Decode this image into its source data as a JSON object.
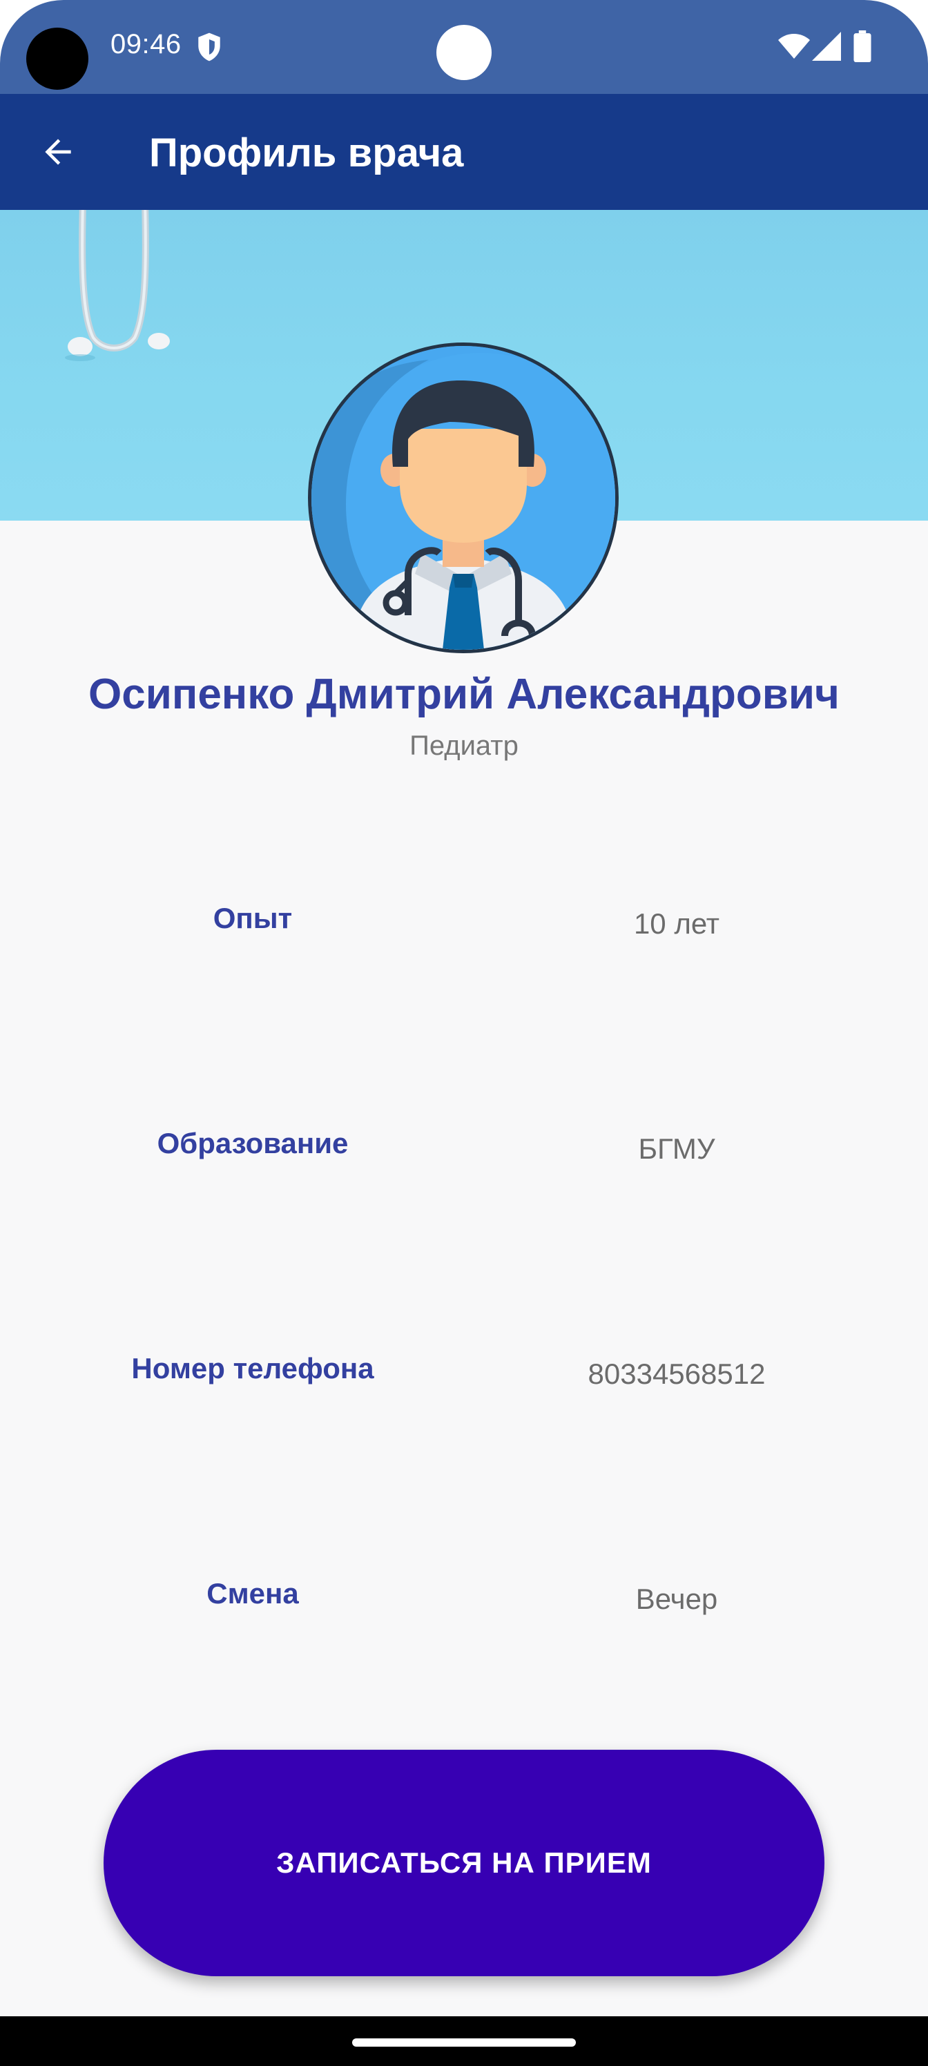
{
  "status_bar": {
    "time": "09:46",
    "icons": [
      "shield-icon",
      "wifi-icon",
      "signal-icon",
      "battery-icon"
    ]
  },
  "app_bar": {
    "title": "Профиль врача",
    "back_icon": "arrow-left-icon"
  },
  "doctor": {
    "name": "Осипенко Дмитрий Александрович",
    "specialty": "Педиатр"
  },
  "info": [
    {
      "label": "Опыт",
      "value": "10 лет"
    },
    {
      "label": "Образование",
      "value": "БГМУ"
    },
    {
      "label": "Номер телефона",
      "value": "80334568512"
    },
    {
      "label": "Смена",
      "value": "Вечер"
    }
  ],
  "action": {
    "book_label": "ЗАПИСАТЬСЯ НА ПРИЕМ"
  },
  "colors": {
    "status_bar": "#3f64a6",
    "app_bar": "#163a8a",
    "accent_text": "#3340a0",
    "button": "#3700b3",
    "banner": "#86d8f0"
  }
}
